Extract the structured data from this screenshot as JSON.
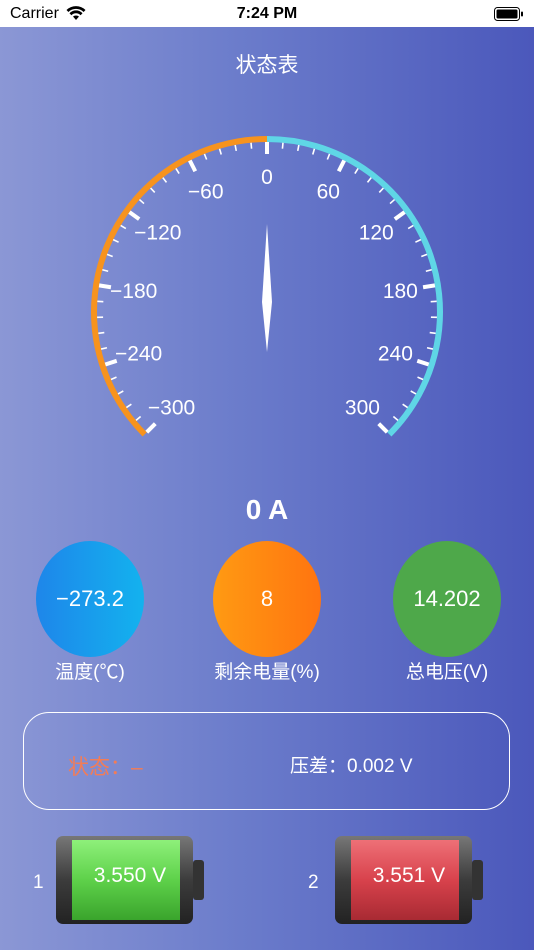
{
  "status_bar": {
    "carrier": "Carrier",
    "time": "7:24 PM",
    "icons": [
      "wifi-icon",
      "battery-icon"
    ]
  },
  "page": {
    "title": "状态表"
  },
  "gauge": {
    "tick_labels": [
      "−300",
      "−240",
      "−180",
      "−120",
      "−60",
      "0",
      "60",
      "120",
      "180",
      "240",
      "300"
    ],
    "tick_values": [
      -300,
      -240,
      -180,
      -120,
      -60,
      0,
      60,
      120,
      180,
      240,
      300
    ],
    "min": -300,
    "max": 300,
    "value": 0,
    "negative_arc_color": "#f7931e",
    "positive_arc_color": "#5fd6e6",
    "reading": "0 A"
  },
  "metrics": [
    {
      "value": "−273.2",
      "label": "温度(℃)",
      "color": "#1a9cec"
    },
    {
      "value": "8",
      "label": "剩余电量(%)",
      "color": "#ff8712"
    },
    {
      "value": "14.202",
      "label": "总电压(V)",
      "color": "#4ea84a"
    }
  ],
  "status_panel": {
    "status_label": "状态：–",
    "pressure_diff": "压差：0.002 V"
  },
  "cells": [
    {
      "index": "1",
      "voltage": "3.550 V",
      "color": "#5ed14a"
    },
    {
      "index": "2",
      "voltage": "3.551 V",
      "color": "#d8424c"
    }
  ]
}
